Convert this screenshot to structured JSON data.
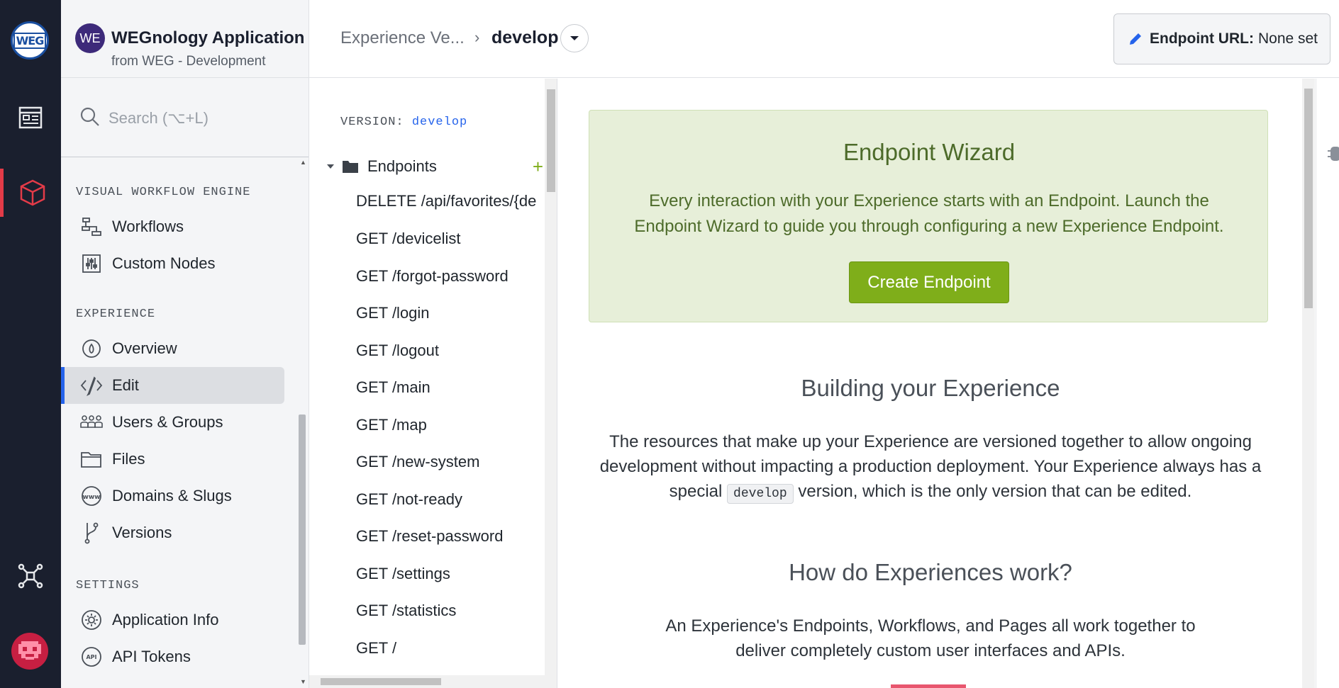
{
  "app": {
    "badge": "WE",
    "name": "WEGnology Application",
    "subtitle": "from WEG - Development",
    "rail_logo": "WEG"
  },
  "search": {
    "placeholder": "Search (⌥+L)"
  },
  "sidebar": {
    "sections": [
      {
        "title": "VISUAL WORKFLOW ENGINE",
        "items": [
          {
            "label": "Workflows",
            "icon": "workflows-icon"
          },
          {
            "label": "Custom Nodes",
            "icon": "custom-nodes-icon"
          }
        ]
      },
      {
        "title": "EXPERIENCE",
        "items": [
          {
            "label": "Overview",
            "icon": "overview-icon"
          },
          {
            "label": "Edit",
            "icon": "edit-code-icon",
            "active": true
          },
          {
            "label": "Users & Groups",
            "icon": "users-groups-icon"
          },
          {
            "label": "Files",
            "icon": "folder-icon"
          },
          {
            "label": "Domains & Slugs",
            "icon": "www-icon"
          },
          {
            "label": "Versions",
            "icon": "branch-icon"
          }
        ]
      },
      {
        "title": "SETTINGS",
        "items": [
          {
            "label": "Application Info",
            "icon": "gear-icon"
          },
          {
            "label": "API Tokens",
            "icon": "api-icon"
          }
        ]
      }
    ]
  },
  "header": {
    "breadcrumb_parent": "Experience Ve...",
    "breadcrumb_sep": "›",
    "breadcrumb_current": "develop",
    "endpoint_url_label": "Endpoint URL:",
    "endpoint_url_value": "None set"
  },
  "tree": {
    "version_label": "VERSION:",
    "version_value": "develop",
    "folder": "Endpoints",
    "items": [
      "DELETE /api/favorites/{de",
      "GET /devicelist",
      "GET /forgot-password",
      "GET /login",
      "GET /logout",
      "GET /main",
      "GET /map",
      "GET /new-system",
      "GET /not-ready",
      "GET /reset-password",
      "GET /settings",
      "GET /statistics",
      "GET /"
    ]
  },
  "main": {
    "wizard_title": "Endpoint Wizard",
    "wizard_text": "Every interaction with your Experience starts with an Endpoint. Launch the Endpoint Wizard to guide you through configuring a new Experience Endpoint.",
    "wizard_button": "Create Endpoint",
    "section1_title": "Building your Experience",
    "section1_text_a": "The resources that make up your Experience are versioned together to allow ongoing development without impacting a production deployment. Your Experience always has a special",
    "section1_code": "develop",
    "section1_text_b": "version, which is the only version that can be edited.",
    "section2_title": "How do Experiences work?",
    "section2_text": "An Experience's Endpoints, Workflows, and Pages all work together to deliver completely custom user interfaces and APIs."
  },
  "colors": {
    "rail": "#1a1f2e",
    "accent": "#2563eb",
    "wizard_bg": "#e7efd9",
    "wizard_button": "#7fae1a",
    "rail_active": "#e33b48"
  }
}
